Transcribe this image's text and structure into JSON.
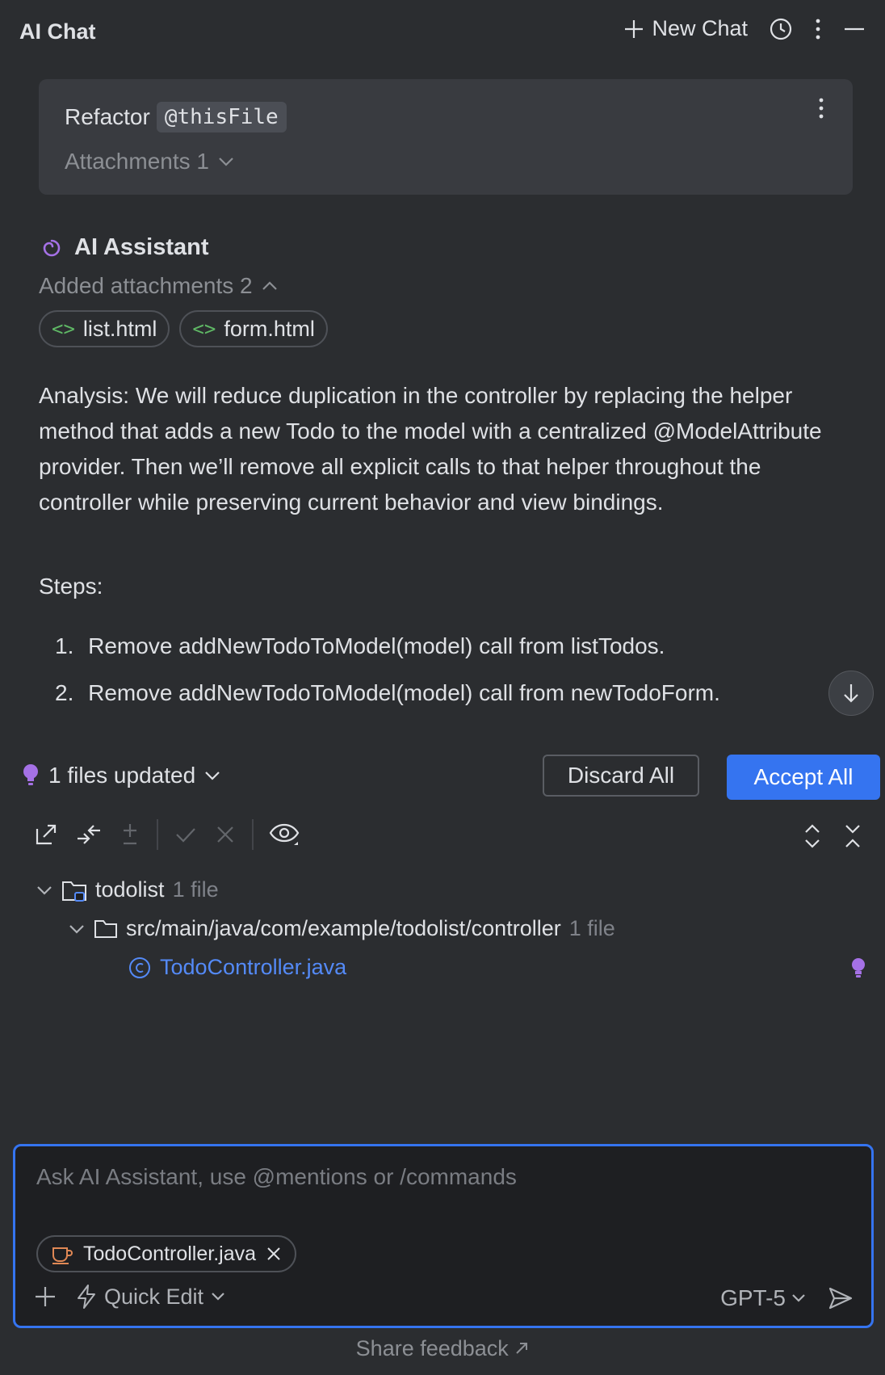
{
  "header": {
    "title": "AI Chat",
    "new_chat_label": "New Chat"
  },
  "user_message": {
    "text": "Refactor",
    "mention": "@thisFile",
    "attachments_label": "Attachments 1"
  },
  "assistant": {
    "name": "AI Assistant",
    "added_attachments_label": "Added attachments 2",
    "attachments": [
      {
        "name": "list.html"
      },
      {
        "name": "form.html"
      }
    ],
    "analysis": "Analysis: We will reduce duplication in the controller by replacing the helper method that adds a new Todo to the model with a centralized @ModelAttribute provider. Then we’ll remove all explicit calls to that helper throughout the controller while preserving current behavior and view bindings.",
    "steps_label": "Steps:",
    "steps": [
      {
        "num": "1.",
        "text": "Remove addNewTodoToModel(model) call from listTodos."
      },
      {
        "num": "2.",
        "text": "Remove addNewTodoToModel(model) call from newTodoForm."
      }
    ]
  },
  "changes": {
    "files_updated_label": "1 files updated",
    "discard_label": "Discard All",
    "accept_label": "Accept All",
    "tree": {
      "project_name": "todolist",
      "project_count": "1 file",
      "folder_path": "src/main/java/com/example/todolist/controller",
      "folder_count": "1 file",
      "file_name": "TodoController.java"
    }
  },
  "input": {
    "placeholder": "Ask AI Assistant, use @mentions or /commands",
    "context_file": "TodoController.java",
    "quick_edit_label": "Quick Edit",
    "model_label": "GPT-5"
  },
  "footer": {
    "feedback_label": "Share feedback"
  },
  "colors": {
    "background": "#2b2d30",
    "accent": "#3574f0",
    "link": "#548af7",
    "ai_purple": "#a571e6",
    "html_green": "#5fb865",
    "java_orange": "#e08855"
  },
  "icons": [
    "plus-icon",
    "history-icon",
    "more-vertical-icon",
    "minimize-icon",
    "chevron-down-icon",
    "chevron-up-icon",
    "ai-spiral-icon",
    "code-icon",
    "arrow-down-icon",
    "bulb-icon",
    "open-in-editor-icon",
    "merge-icon",
    "plus-minus-icon",
    "check-icon",
    "close-icon",
    "eye-icon",
    "expand-icon",
    "collapse-icon",
    "folder-icon",
    "class-icon",
    "java-file-icon",
    "lightning-icon",
    "send-icon",
    "arrow-up-right-icon"
  ]
}
